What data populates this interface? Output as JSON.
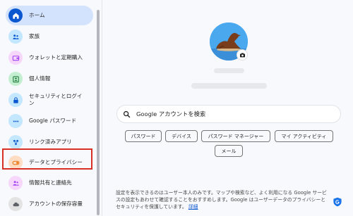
{
  "sidebar": {
    "items": [
      {
        "label": "ホーム",
        "icon": "home-icon",
        "active": true
      },
      {
        "label": "家族",
        "icon": "family-icon"
      },
      {
        "label": "ウォレットと定期購入",
        "icon": "wallet-icon"
      },
      {
        "label": "個人情報",
        "icon": "personal-info-icon"
      },
      {
        "label": "セキュリティとログイン",
        "icon": "lock-icon"
      },
      {
        "label": "Google パスワード",
        "icon": "password-icon"
      },
      {
        "label": "リンク済みアプリ",
        "icon": "linked-apps-icon"
      },
      {
        "label": "データとプライバシー",
        "icon": "toggle-icon"
      },
      {
        "label": "情報共有と連絡先",
        "icon": "people-icon"
      },
      {
        "label": "アカウントの保存容量",
        "icon": "cloud-icon"
      }
    ]
  },
  "search": {
    "placeholder": "Google アカウントを検索"
  },
  "chips": [
    "パスワード",
    "デバイス",
    "パスワード マネージャー",
    "マイ アクティビティ",
    "メール"
  ],
  "footer": {
    "text": "設定を表示できるのはユーザー本人のみです。マップや検索など、よく利用になる Google サービスの設定もあわせて確認することをおすすめします。Google はユーザーデータのプライバシーとセキュリティを保護しています。",
    "link": "詳細"
  }
}
